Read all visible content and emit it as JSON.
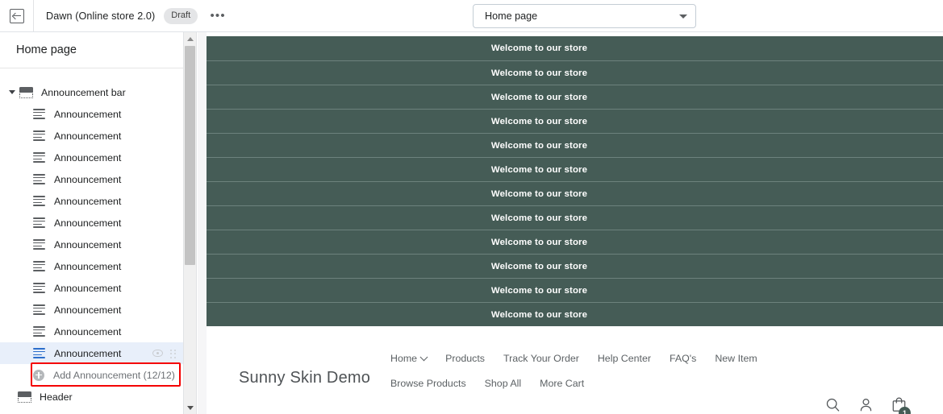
{
  "topbar": {
    "back_icon": "exit-icon",
    "theme_name": "Dawn (Online store 2.0)",
    "status_badge": "Draft",
    "more_label": "•••",
    "page_select": {
      "value": "Home page",
      "icon": "chevron-down-icon"
    }
  },
  "sidebar": {
    "title": "Home page",
    "sections": [
      {
        "label": "Announcement bar",
        "icon": "section-icon",
        "expanded": true,
        "children": [
          {
            "label": "Announcement",
            "icon": "text-lines-icon",
            "selected": false
          },
          {
            "label": "Announcement",
            "icon": "text-lines-icon",
            "selected": false
          },
          {
            "label": "Announcement",
            "icon": "text-lines-icon",
            "selected": false
          },
          {
            "label": "Announcement",
            "icon": "text-lines-icon",
            "selected": false
          },
          {
            "label": "Announcement",
            "icon": "text-lines-icon",
            "selected": false
          },
          {
            "label": "Announcement",
            "icon": "text-lines-icon",
            "selected": false
          },
          {
            "label": "Announcement",
            "icon": "text-lines-icon",
            "selected": false
          },
          {
            "label": "Announcement",
            "icon": "text-lines-icon",
            "selected": false
          },
          {
            "label": "Announcement",
            "icon": "text-lines-icon",
            "selected": false
          },
          {
            "label": "Announcement",
            "icon": "text-lines-icon",
            "selected": false
          },
          {
            "label": "Announcement",
            "icon": "text-lines-icon",
            "selected": false
          },
          {
            "label": "Announcement",
            "icon": "text-lines-icon",
            "selected": true,
            "actions": [
              "eye-icon",
              "drag-handle-icon"
            ]
          }
        ],
        "add_row": {
          "label": "Add Announcement (12/12)",
          "icon": "plus-circle-icon",
          "disabled": true
        }
      },
      {
        "label": "Header",
        "icon": "section-icon",
        "expanded": false
      }
    ],
    "highlight_color": "#f40000",
    "selected_bg": "#e8effa",
    "selected_icon_color": "#2c6ecb"
  },
  "scrollbar": {
    "up_arrow": "caret-up-icon",
    "down_arrow": "caret-down-icon"
  },
  "preview": {
    "announcement_bar_color": "#455c56",
    "announcement_text": "Welcome to our store",
    "announcements": [
      "Welcome to our store",
      "Welcome to our store",
      "Welcome to our store",
      "Welcome to our store",
      "Welcome to our store",
      "Welcome to our store",
      "Welcome to our store",
      "Welcome to our store",
      "Welcome to our store",
      "Welcome to our store",
      "Welcome to our store",
      "Welcome to our store"
    ],
    "store": {
      "logo": "Sunny Skin Demo",
      "nav_row_1": [
        {
          "label": "Home",
          "has_chevron": true
        },
        {
          "label": "Products",
          "has_chevron": false
        },
        {
          "label": "Track Your Order",
          "has_chevron": false
        },
        {
          "label": "Help Center",
          "has_chevron": false
        },
        {
          "label": "FAQ's",
          "has_chevron": false
        },
        {
          "label": "New Item",
          "has_chevron": false
        }
      ],
      "nav_row_2": [
        {
          "label": "Browse Products",
          "has_chevron": false
        },
        {
          "label": "Shop All",
          "has_chevron": false
        },
        {
          "label": "More Cart",
          "has_chevron": false
        }
      ],
      "actions": [
        {
          "icon": "search-icon"
        },
        {
          "icon": "account-icon"
        },
        {
          "icon": "cart-icon",
          "badge": "1"
        }
      ],
      "cart_badge_color": "#455c56"
    }
  }
}
